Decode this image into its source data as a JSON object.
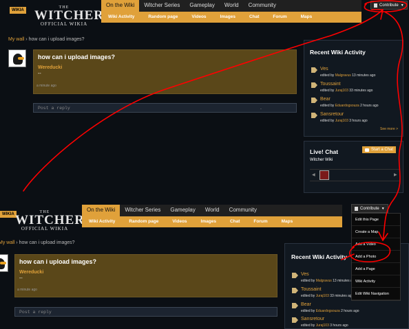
{
  "colors": {
    "accent": "#e0a13a",
    "annotation": "#ff0000",
    "post_bg": "#5a4719"
  },
  "header": {
    "wikia_badge": "WIKIA",
    "logo": {
      "the": "THE",
      "main": "WITCHER",
      "sub": "OFFICIAL WIKIA"
    },
    "tabs": [
      "On the Wiki",
      "Witcher Series",
      "Gameplay",
      "World",
      "Community"
    ],
    "subnav": [
      "Wiki Activity",
      "Random page",
      "Videos",
      "Images",
      "Chat",
      "Forum",
      "Maps"
    ],
    "contribute_label": "Contribute"
  },
  "breadcrumb": {
    "wall": "My wall",
    "sep": "›",
    "thread": "how can i upload images?"
  },
  "post": {
    "title": "how can i upload images?",
    "author": "Wereducki",
    "body": "--",
    "time": "a minute ago"
  },
  "reply_placeholder": "Post a reply",
  "reply_marker": ".",
  "activity": {
    "title": "Recent Wiki Activity",
    "items": [
      {
        "name": "Ves",
        "prefix": "edited by",
        "user": "Malgravus",
        "time": "13 minutes ago"
      },
      {
        "name": "Toussaint",
        "prefix": "edited by",
        "user": "Juraj103",
        "time": "33 minutes ago"
      },
      {
        "name": "Bear",
        "prefix": "edited by",
        "user": "Eduardogsouza",
        "time": "2 hours ago"
      },
      {
        "name": "Sansretour",
        "prefix": "edited by",
        "user": "Juraj103",
        "time": "3 hours ago"
      }
    ],
    "see_more": "See more >"
  },
  "chat": {
    "title": "Live! Chat",
    "button": "Start a Chat",
    "wiki": "Witcher Wiki",
    "prev": "◀",
    "next": "▶"
  },
  "dropdown": [
    "Edit this Page",
    "Create a Map",
    "Add a Video",
    "Add a Photo",
    "Add a Page",
    "Wiki Activity",
    "Edit Wiki Navigation"
  ]
}
